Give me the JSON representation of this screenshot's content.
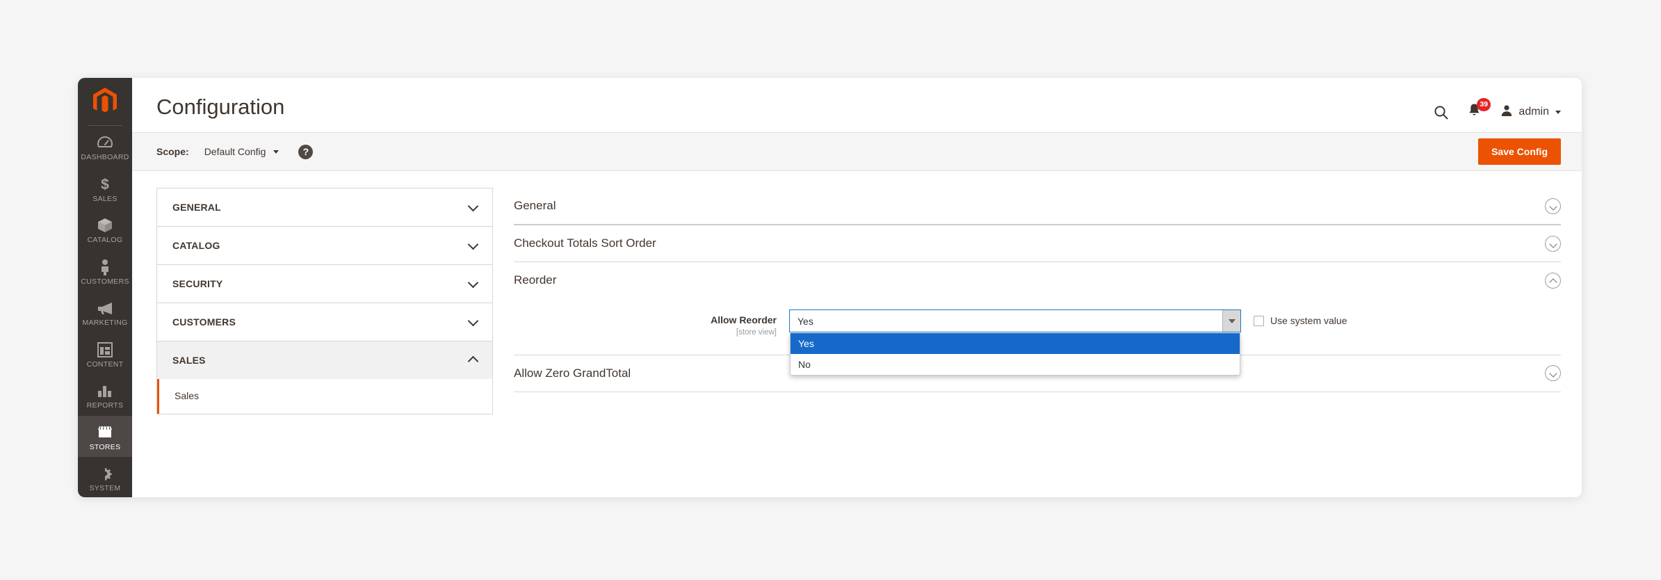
{
  "header": {
    "title": "Configuration",
    "search_icon": "search-icon",
    "notifications_icon": "bell-icon",
    "notifications_count": "39",
    "user_icon": "user-avatar-icon",
    "user_name": "admin"
  },
  "sidebar": {
    "logo": "magento-logo-icon",
    "items": [
      {
        "label": "DASHBOARD",
        "icon": "dashboard-gauge-icon",
        "active": false
      },
      {
        "label": "SALES",
        "icon": "dollar-icon",
        "active": false
      },
      {
        "label": "CATALOG",
        "icon": "box-icon",
        "active": false
      },
      {
        "label": "CUSTOMERS",
        "icon": "person-icon",
        "active": false
      },
      {
        "label": "MARKETING",
        "icon": "megaphone-icon",
        "active": false
      },
      {
        "label": "CONTENT",
        "icon": "layout-icon",
        "active": false
      },
      {
        "label": "REPORTS",
        "icon": "bar-chart-icon",
        "active": false
      },
      {
        "label": "STORES",
        "icon": "store-icon",
        "active": true
      },
      {
        "label": "SYSTEM",
        "icon": "gear-icon",
        "active": false
      }
    ]
  },
  "scope_bar": {
    "label": "Scope:",
    "value": "Default Config",
    "caret_icon": "caret-down-icon",
    "help_icon": "question-mark-icon",
    "save_button": "Save Config",
    "save_button_color": "#eb5202"
  },
  "config_nav": {
    "sections": [
      {
        "label": "GENERAL",
        "open": false,
        "chevron": "chevron-down-icon"
      },
      {
        "label": "CATALOG",
        "open": false,
        "chevron": "chevron-down-icon"
      },
      {
        "label": "SECURITY",
        "open": false,
        "chevron": "chevron-down-icon"
      },
      {
        "label": "CUSTOMERS",
        "open": false,
        "chevron": "chevron-down-icon"
      },
      {
        "label": "SALES",
        "open": true,
        "chevron": "chevron-up-icon"
      }
    ],
    "sub_items": [
      {
        "label": "Sales",
        "active": true
      }
    ]
  },
  "settings": {
    "sections": [
      {
        "title": "General",
        "expanded": false,
        "chevron": "circle-chevron-down-icon"
      },
      {
        "title": "Checkout Totals Sort Order",
        "expanded": false,
        "chevron": "circle-chevron-down-icon"
      },
      {
        "title": "Reorder",
        "expanded": true,
        "chevron": "circle-chevron-up-icon"
      },
      {
        "title": "Allow Zero GrandTotal",
        "expanded": false,
        "chevron": "circle-chevron-down-icon"
      }
    ],
    "reorder_field": {
      "label": "Allow Reorder",
      "scope_note": "[store view]",
      "selected_value": "Yes",
      "dropdown_open": true,
      "options": [
        {
          "label": "Yes",
          "selected": true
        },
        {
          "label": "No",
          "selected": false
        }
      ],
      "highlight_color": "#1669c9",
      "focus_border_color": "#1979c3",
      "use_system_value_label": "Use system value",
      "use_system_value_checked": false
    }
  }
}
